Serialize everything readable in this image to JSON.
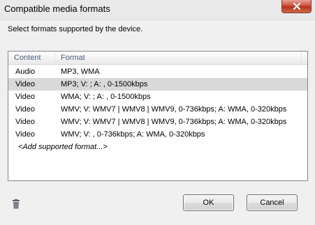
{
  "window": {
    "title": "Compatible media formats"
  },
  "instructions": "Select formats supported by the device.",
  "table": {
    "columns": [
      "Content",
      "Format"
    ],
    "rows": [
      {
        "content": "Audio",
        "format": "MP3, WMA"
      },
      {
        "content": "Video",
        "format": "MP3; V: ; A: , 0-1500kbps"
      },
      {
        "content": "Video",
        "format": "WMA; V: ; A: , 0-1500kbps"
      },
      {
        "content": "Video",
        "format": "WMV; V: WMV7 | WMV8 | WMV9, 0-736kbps; A: WMA, 0-320kbps"
      },
      {
        "content": "Video",
        "format": "WMV; V: WMV7 | WMV8 | WMV9, 0-736kbps; A: WMA, 0-320kbps"
      },
      {
        "content": "Video",
        "format": "WMV; V: , 0-736kbps; A: WMA, 0-320kbps"
      }
    ],
    "add_label": "<Add supported format...>"
  },
  "buttons": {
    "ok": "OK",
    "cancel": "Cancel"
  },
  "icons": {
    "close": "close-icon",
    "delete": "trash-icon"
  },
  "colors": {
    "close_button": "#c9472f",
    "selected_row": "#d9d9d9",
    "header_text": "#4c607a"
  }
}
